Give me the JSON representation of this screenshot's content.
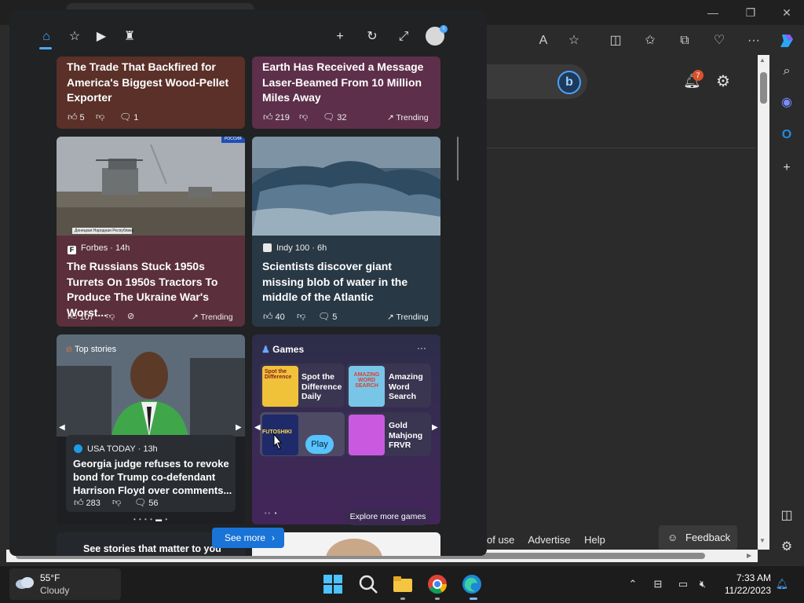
{
  "browser": {
    "window_buttons": [
      "—",
      "❐",
      "✕"
    ],
    "footer_links": [
      "of use",
      "Advertise",
      "Help"
    ],
    "feedback_label": "Feedback",
    "notification_count": "7"
  },
  "widgets": {
    "cards_top": [
      {
        "title": "The Trade That Backfired for America's Biggest Wood-Pellet Exporter",
        "likes": "5",
        "comments": "1"
      },
      {
        "title": "Earth Has Received a Message Laser-Beamed From 10 Million Miles Away",
        "likes": "219",
        "comments": "32",
        "trending": "Trending"
      }
    ],
    "cards_mid": [
      {
        "source": "Forbes · 14h",
        "title": "The Russians Stuck 1950s Turrets On 1950s Tractors To Produce The Ukraine War's Worst...",
        "likes": "107",
        "trending": "Trending",
        "image_tag": "РОССИЯ",
        "image_caption": "Донецкая Народная Республика"
      },
      {
        "source": "Indy 100 · 6h",
        "title": "Scientists discover giant missing blob of water in the middle of the Atlantic",
        "likes": "40",
        "comments": "5",
        "trending": "Trending"
      }
    ],
    "top_stories": {
      "label": "Top stories",
      "source": "USA TODAY · 13h",
      "title": "Georgia judge refuses to revoke bond for Trump co-defendant Harrison Floyd over comments...",
      "likes": "283",
      "comments": "56"
    },
    "games": {
      "label": "Games",
      "more": "···",
      "items": [
        {
          "name": "Spot the Difference Daily",
          "thumb_text": "Spot the Difference"
        },
        {
          "name": "Amazing Word Search",
          "thumb_text": "AMAZING WORD SEARCH"
        },
        {
          "name": "",
          "thumb_text": "FUTOSHIKI"
        },
        {
          "name": "Gold Mahjong FRVR",
          "thumb_text": ""
        }
      ],
      "play_label": "Play",
      "explore_label": "Explore more games"
    },
    "bottom": {
      "promo_title": "See stories that matter to you",
      "see_more": "See more"
    }
  },
  "taskbar": {
    "weather_temp": "55°F",
    "weather_condition": "Cloudy",
    "time": "7:33 AM",
    "date": "11/22/2023"
  }
}
